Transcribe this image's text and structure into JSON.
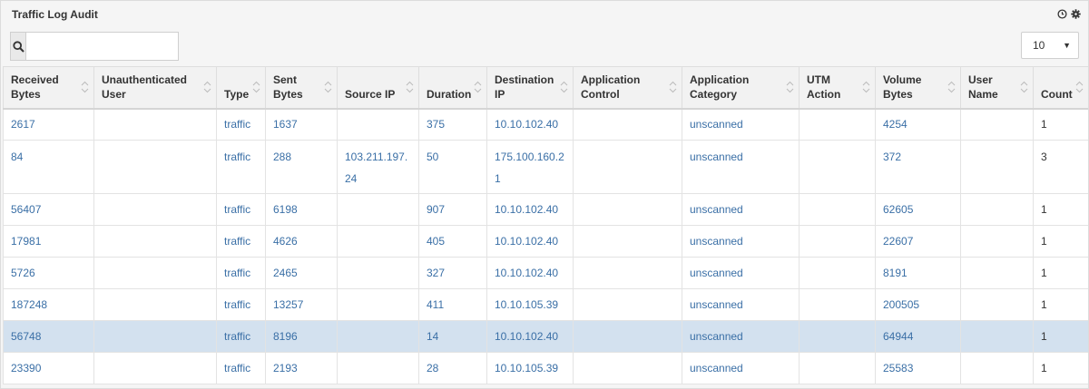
{
  "panel": {
    "title": "Traffic Log Audit"
  },
  "search": {
    "placeholder": ""
  },
  "page_size": {
    "value": "10"
  },
  "columns": [
    "Received Bytes",
    "Unauthenticated User",
    "Type",
    "Sent Bytes",
    "Source IP",
    "Duration",
    "Destination IP",
    "Application Control",
    "Application Category",
    "UTM Action",
    "Volume Bytes",
    "User Name",
    "Count"
  ],
  "rows": [
    [
      "2617",
      "",
      "traffic",
      "1637",
      "",
      "375",
      "10.10.102.40",
      "",
      "unscanned",
      "",
      "4254",
      "",
      "1"
    ],
    [
      "84",
      "",
      "traffic",
      "288",
      "103.211.197.24",
      "50",
      "175.100.160.21",
      "",
      "unscanned",
      "",
      "372",
      "",
      "3"
    ],
    [
      "56407",
      "",
      "traffic",
      "6198",
      "",
      "907",
      "10.10.102.40",
      "",
      "unscanned",
      "",
      "62605",
      "",
      "1"
    ],
    [
      "17981",
      "",
      "traffic",
      "4626",
      "",
      "405",
      "10.10.102.40",
      "",
      "unscanned",
      "",
      "22607",
      "",
      "1"
    ],
    [
      "5726",
      "",
      "traffic",
      "2465",
      "",
      "327",
      "10.10.102.40",
      "",
      "unscanned",
      "",
      "8191",
      "",
      "1"
    ],
    [
      "187248",
      "",
      "traffic",
      "13257",
      "",
      "411",
      "10.10.105.39",
      "",
      "unscanned",
      "",
      "200505",
      "",
      "1"
    ],
    [
      "56748",
      "",
      "traffic",
      "8196",
      "",
      "14",
      "10.10.102.40",
      "",
      "unscanned",
      "",
      "64944",
      "",
      "1"
    ],
    [
      "23390",
      "",
      "traffic",
      "2193",
      "",
      "28",
      "10.10.105.39",
      "",
      "unscanned",
      "",
      "25583",
      "",
      "1"
    ]
  ],
  "selected_row": 6,
  "colors": {
    "link": "#3a6fa6",
    "selected_row": "#d3e1ef",
    "header_bg": "#f2f2f2"
  }
}
